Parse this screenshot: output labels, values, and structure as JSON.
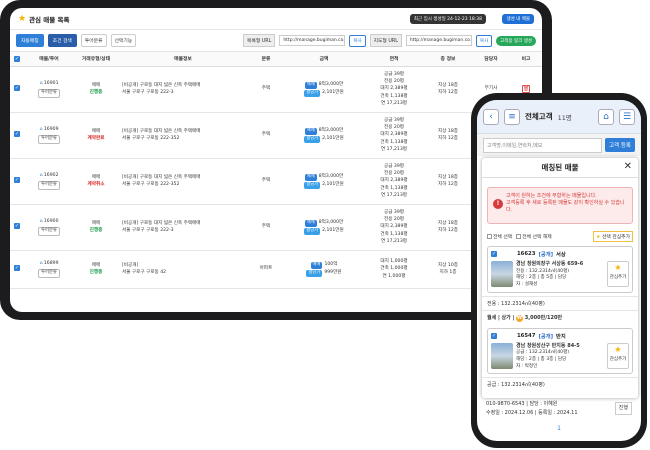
{
  "tablet": {
    "title": "관심 매물 목록",
    "date_badge": "최근 임시 생성일 24-12-23 18:38",
    "register_btn": "생성 내 매물",
    "toolbar": {
      "btn_auto": "자동매칭",
      "btn_cond": "조건 검색",
      "sel_type": "투어분류",
      "sel_fn": "선택기능",
      "list_url_label": "목록형 URL",
      "list_url": "http://manage.bugiman.co.kr/s",
      "copy1": "복사",
      "map_url_label": "지도형 URL",
      "map_url": "http://manage.bugiman.co.kr/s",
      "copy2": "복사",
      "kakao_btn": "고객용 링크 생성"
    },
    "headers": [
      "",
      "매물/투어",
      "거래유형/상태",
      "매물정보",
      "분류",
      "금액",
      "면적",
      "층 정보",
      "담당자",
      "비고"
    ],
    "rows": [
      {
        "id": "16901",
        "tour": "투어분류",
        "deal": "매매",
        "status": "진행중",
        "status_color": "#159848",
        "name": "[비공개] 구로동 대지 넓은 신축 주택매매",
        "addr": "서울 구로구 구로동 222-3",
        "cat": "주택",
        "price1": "8억3,000만",
        "price2": "2,101만원",
        "area": [
          "공급 39평",
          "전용 20평",
          "대지 2,389평",
          "건축 1,138평",
          "연 17,213평"
        ],
        "floor": [
          "지상 18층",
          "지하 12층"
        ],
        "agent": "부기사",
        "trash": true
      },
      {
        "id": "16909",
        "tour": "투어분류",
        "deal": "매매",
        "status": "계약완료",
        "status_color": "#d62020",
        "name": "[비공개] 구로동 대지 넓은 신축 주택매매",
        "addr": "서울 구로구 구로동 222-352",
        "cat": "주택",
        "price1": "8억3,000만",
        "price2": "2,101만원",
        "area": [
          "공급 39평",
          "전용 20평",
          "대지 2,389평",
          "건축 1,138평",
          "연 17,213평"
        ],
        "floor": [
          "지상 18층",
          "지하 12층"
        ],
        "agent": "",
        "trash": false
      },
      {
        "id": "16902",
        "tour": "투어분류",
        "deal": "매매",
        "status": "계약취소",
        "status_color": "#d62020",
        "name": "[비공개] 구로동 대지 넓은 신축 주택매매",
        "addr": "서울 구로구 구로동 222-352",
        "cat": "주택",
        "price1": "8억3,000만",
        "price2": "2,101만원",
        "area": [
          "공급 39평",
          "전용 20평",
          "대지 2,389평",
          "건축 1,138평",
          "연 17,213평"
        ],
        "floor": [
          "지상 18층",
          "지하 12층"
        ],
        "agent": "",
        "trash": false
      },
      {
        "id": "16900",
        "tour": "투어분류",
        "deal": "매매",
        "status": "진행중",
        "status_color": "#159848",
        "name": "[비공개] 구로동 대지 넓은 신축 주택매매",
        "addr": "서울 구로구 구로동 222-3",
        "cat": "주택",
        "price1": "8억3,000만",
        "price2": "2,101만원",
        "area": [
          "공급 39평",
          "전용 20평",
          "대지 2,389평",
          "건축 1,138평",
          "연 17,213평"
        ],
        "floor": [
          "지상 18층",
          "지하 12층"
        ],
        "agent": "",
        "trash": false
      },
      {
        "id": "16899",
        "tour": "투어분류",
        "deal": "매매",
        "status": "진행중",
        "status_color": "#159848",
        "name": "[비공개]",
        "addr": "서울 구로구 구로동 42",
        "cat": "아파트",
        "price1": "100억",
        "price2": "999만원",
        "area": [
          "대지 1,000평",
          "건축 1,000평",
          "연 1,000평"
        ],
        "floor": [
          "지상 10층",
          "지하 1층"
        ],
        "agent": "",
        "trash": false
      }
    ]
  },
  "phone": {
    "title": "전체고객",
    "count": "11명",
    "search_placeholder": "고객명,이메일,연락처,메모",
    "search_btn": "고객 등록",
    "modal_title": "매칭된 매물",
    "alert1": "고객이 원하는 조건에 부합하는 매물입니다.",
    "alert2": "고객등록 후 새로 등록된 매물도 같이 확인하실 수 있습니다.",
    "opt_all": "전체 선택",
    "opt_del": "전체 선택 해제",
    "opt_fav": "선택 관심추가",
    "cards": [
      {
        "id": "16623",
        "pub": "[공개]",
        "title": "서상",
        "addr": "경남 창원의창구 서상동 659-6",
        "l1": "전용 : 132.2314㎡(40평)",
        "l2": "해당 : 2층 | 총 5층 | 담당",
        "l3": "자 : 설재성",
        "fav": "관심추가"
      },
      {
        "id": "16547",
        "pub": "[공개]",
        "title": "반지",
        "addr": "경남 창원성산구 반지동 84-5",
        "l1": "공급 : 132.2314㎡(40평)",
        "l2": "해당 : 2층 | 총 3층 | 담당",
        "l3": "자 : 박정인",
        "fav": "관심추가"
      }
    ],
    "sep1": "전용 : 132.2314㎡(40평)",
    "price_line": "월세 | 상가 | ",
    "price_val": "3,000만/120만",
    "sep2": "공급 : 132.2314㎡(40평)",
    "bottom_line": "010-9870-6543 | 담당 : 이혜원",
    "bottom_line2": "수정일 : 2024.12.06 | 등록일 : 2024.11",
    "bottom_sel": "진행",
    "page": "1"
  }
}
